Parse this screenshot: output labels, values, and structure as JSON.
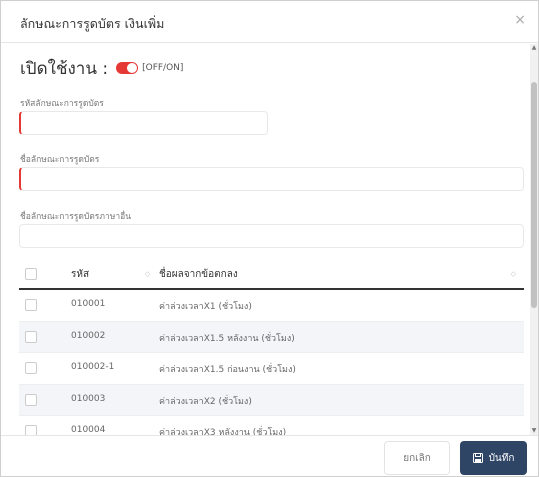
{
  "modal": {
    "title": "ลักษณะการรูดบัตร เงินเพิ่ม",
    "close_glyph": "×"
  },
  "toggle": {
    "label": "เปิดใช้งาน :",
    "state_text": "[OFF/ON]",
    "on": true,
    "color": "#e53935"
  },
  "fields": {
    "code_label": "รหัสลักษณะการรูดบัตร",
    "code_value": "",
    "name_label": "ชื่อลักษณะการรูดบัตร",
    "name_value": "",
    "alt_name_label": "ชื่อลักษณะการรูดบัตรภาษาอื่น",
    "alt_name_value": ""
  },
  "table": {
    "headers": {
      "code": "รหัส",
      "name": "ชื่อผลจากข้อตกลง"
    },
    "rows": [
      {
        "code": "010001",
        "name": "ค่าล่วงเวลาX1 (ชั่วโมง)"
      },
      {
        "code": "010002",
        "name": "ค่าล่วงเวลาX1.5 หลังงาน (ชั่วโมง)"
      },
      {
        "code": "010002-1",
        "name": "ค่าล่วงเวลาX1.5 ก่อนงาน (ชั่วโมง)"
      },
      {
        "code": "010003",
        "name": "ค่าล่วงเวลาX2 (ชั่วโมง)"
      },
      {
        "code": "010004",
        "name": "ค่าล่วงเวลาX3 หลังงาน (ชั่วโมง)"
      }
    ]
  },
  "footer": {
    "cancel_label": "ยกเลิก",
    "save_label": "บันทึก",
    "save_color": "#2f4566"
  },
  "icons": {
    "close": "close-icon",
    "save": "floppy-disk-icon",
    "sort": "sort-icon"
  }
}
